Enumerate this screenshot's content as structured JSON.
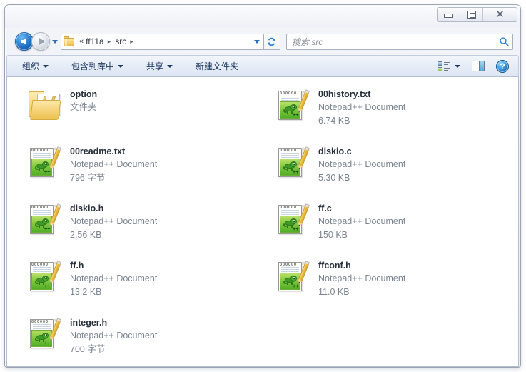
{
  "window": {
    "controls": {
      "minimize_label": "最小化",
      "maximize_label": "最大化",
      "close_label": "✕"
    }
  },
  "address_bar": {
    "back_label": "后退",
    "forward_label": "前进",
    "history_label": "最近浏览的位置",
    "folder_icon": "folder-icon",
    "breadcrumb": {
      "overflow": "«",
      "items": [
        "ff11a",
        "src"
      ],
      "separator": "▸"
    },
    "refresh_label": "刷新"
  },
  "search": {
    "placeholder": "搜索 src",
    "icon": "search-icon"
  },
  "toolbar": {
    "items": [
      {
        "label": "组织",
        "has_caret": true
      },
      {
        "label": "包含到库中",
        "has_caret": true
      },
      {
        "label": "共享",
        "has_caret": true
      },
      {
        "label": "新建文件夹",
        "has_caret": false
      }
    ],
    "view_options_label": "更改您的视图",
    "preview_pane_label": "显示预览窗格",
    "help_label": "?"
  },
  "files": [
    {
      "name": "option",
      "type": "文件夹",
      "size": "",
      "icon": "folder-icon"
    },
    {
      "name": "00history.txt",
      "type": "Notepad++ Document",
      "size": "6.74 KB",
      "icon": "notepad-plus-plus-document-icon"
    },
    {
      "name": "00readme.txt",
      "type": "Notepad++ Document",
      "size": "796 字节",
      "icon": "notepad-plus-plus-document-icon"
    },
    {
      "name": "diskio.c",
      "type": "Notepad++ Document",
      "size": "5.30 KB",
      "icon": "notepad-plus-plus-document-icon"
    },
    {
      "name": "diskio.h",
      "type": "Notepad++ Document",
      "size": "2.56 KB",
      "icon": "notepad-plus-plus-document-icon"
    },
    {
      "name": "ff.c",
      "type": "Notepad++ Document",
      "size": "150 KB",
      "icon": "notepad-plus-plus-document-icon"
    },
    {
      "name": "ff.h",
      "type": "Notepad++ Document",
      "size": "13.2 KB",
      "icon": "notepad-plus-plus-document-icon"
    },
    {
      "name": "ffconf.h",
      "type": "Notepad++ Document",
      "size": "11.0 KB",
      "icon": "notepad-plus-plus-document-icon"
    },
    {
      "name": "integer.h",
      "type": "Notepad++ Document",
      "size": "700 字节",
      "icon": "notepad-plus-plus-document-icon"
    }
  ],
  "colors": {
    "accent_blue": "#2d6fba",
    "toolbar_text": "#1f3a63",
    "file_name": "#26303c",
    "file_meta": "#7b8592",
    "folder_yellow": "#f5d276",
    "npp_green": "#7cc534"
  }
}
